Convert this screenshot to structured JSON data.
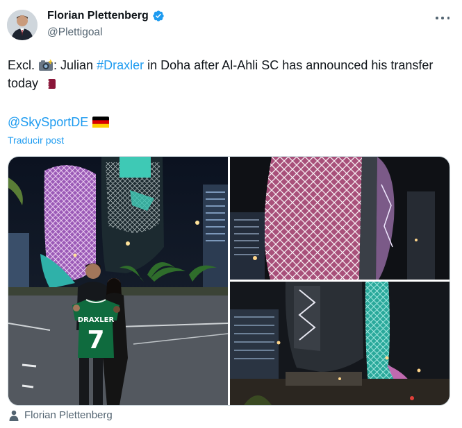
{
  "author": {
    "display_name": "Florian Plettenberg",
    "handle": "@Plettigoal",
    "verified": true
  },
  "tweet": {
    "text_prefix": "Excl.",
    "text_colon": ": Julian",
    "hashtag": "#Draxler",
    "text_rest": "in Doha after Al-Ahli SC has announced his transfer today",
    "mention": "@SkySportDE",
    "translate_label": "Traducir post"
  },
  "media": {
    "jersey_name": "DRAXLER",
    "jersey_number": "7",
    "photo_count": 3
  },
  "tagged": {
    "name": "Florian Plettenberg"
  },
  "icons": {
    "verified": "verified-badge-icon",
    "more": "more-options-icon",
    "camera": "camera-flash-icon",
    "flag_qatar": "qatar-flag-icon",
    "flag_germany": "germany-flag-icon",
    "tag": "person-icon"
  },
  "colors": {
    "link": "#1d9bf0",
    "text": "#0f1419",
    "secondary": "#536471"
  }
}
